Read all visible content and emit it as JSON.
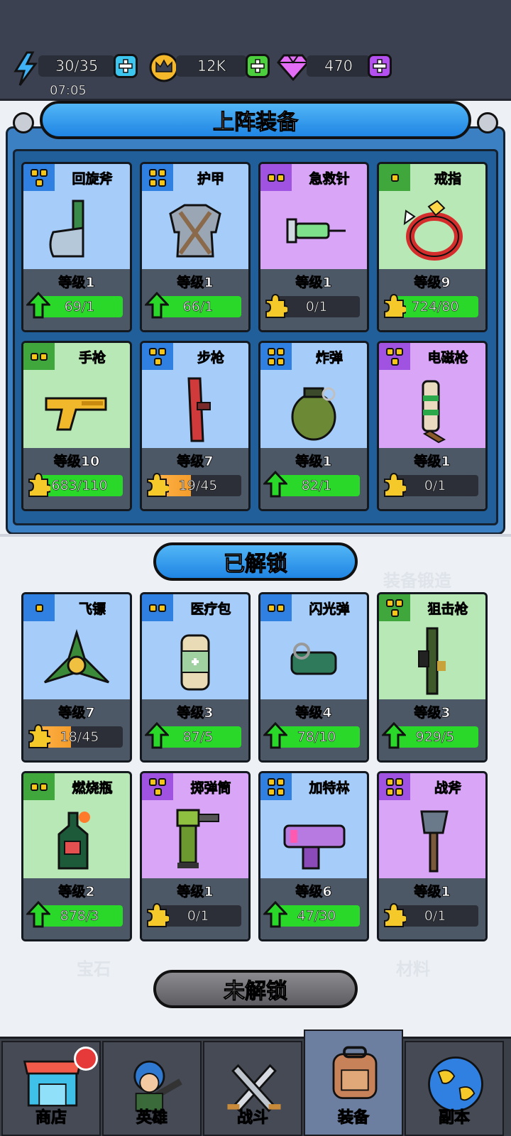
{
  "header": {
    "energy": "30/35",
    "timer": "07:05",
    "crowns": "12K",
    "gems": "470"
  },
  "equipped": {
    "title": "上阵装备",
    "cards": [
      {
        "name": "回旋斧",
        "color": "blue",
        "tag": 3,
        "level": "等级1",
        "progress": "69/1",
        "fill": 1.0,
        "upgrade": true,
        "icon": "axe-icon"
      },
      {
        "name": "护甲",
        "color": "blue",
        "tag": 4,
        "level": "等级1",
        "progress": "66/1",
        "fill": 1.0,
        "upgrade": true,
        "icon": "armor-icon"
      },
      {
        "name": "急救针",
        "color": "purple",
        "tag": 2,
        "level": "等级1",
        "progress": "0/1",
        "fill": 0.0,
        "upgrade": false,
        "icon": "syringe-icon"
      },
      {
        "name": "戒指",
        "color": "green",
        "tag": 1,
        "level": "等级9",
        "progress": "724/80",
        "fill": 1.0,
        "upgrade": false,
        "icon": "ring-icon"
      },
      {
        "name": "手枪",
        "color": "green",
        "tag": 2,
        "level": "等级10",
        "progress": "683/110",
        "fill": 1.0,
        "upgrade": false,
        "icon": "pistol-icon"
      },
      {
        "name": "步枪",
        "color": "blue",
        "tag": 3,
        "level": "等级7",
        "progress": "19/45",
        "fill": 0.42,
        "upgrade": false,
        "icon": "rifle-icon"
      },
      {
        "name": "炸弹",
        "color": "blue",
        "tag": 4,
        "level": "等级1",
        "progress": "82/1",
        "fill": 1.0,
        "upgrade": true,
        "icon": "grenade-icon"
      },
      {
        "name": "电磁枪",
        "color": "purple",
        "tag": 3,
        "level": "等级1",
        "progress": "0/1",
        "fill": 0.0,
        "upgrade": false,
        "icon": "railgun-icon"
      }
    ]
  },
  "unlocked": {
    "title": "已解锁",
    "cards": [
      {
        "name": "飞镖",
        "color": "blue",
        "tag": 1,
        "level": "等级7",
        "progress": "18/45",
        "fill": 0.4,
        "upgrade": false,
        "icon": "shuriken-icon"
      },
      {
        "name": "医疗包",
        "color": "blue",
        "tag": 2,
        "level": "等级3",
        "progress": "87/5",
        "fill": 1.0,
        "upgrade": true,
        "icon": "medkit-icon"
      },
      {
        "name": "闪光弹",
        "color": "blue",
        "tag": 2,
        "level": "等级4",
        "progress": "78/10",
        "fill": 1.0,
        "upgrade": true,
        "icon": "flashbang-icon"
      },
      {
        "name": "狙击枪",
        "color": "green",
        "tag": 3,
        "level": "等级3",
        "progress": "929/5",
        "fill": 1.0,
        "upgrade": true,
        "icon": "sniper-icon"
      },
      {
        "name": "燃烧瓶",
        "color": "green",
        "tag": 2,
        "level": "等级2",
        "progress": "878/3",
        "fill": 1.0,
        "upgrade": true,
        "icon": "molotov-icon"
      },
      {
        "name": "掷弹筒",
        "color": "purple",
        "tag": 3,
        "level": "等级1",
        "progress": "0/1",
        "fill": 0.0,
        "upgrade": false,
        "icon": "launcher-icon"
      },
      {
        "name": "加特林",
        "color": "blue",
        "tag": 4,
        "level": "等级6",
        "progress": "47/30",
        "fill": 1.0,
        "upgrade": true,
        "icon": "gatling-icon"
      },
      {
        "name": "战斧",
        "color": "purple",
        "tag": 4,
        "level": "等级1",
        "progress": "0/1",
        "fill": 0.0,
        "upgrade": false,
        "icon": "battleaxe-icon"
      }
    ]
  },
  "locked": {
    "title": "未解锁"
  },
  "background_text": {
    "forge": "装备锻造",
    "gems": "宝石",
    "materials": "材料"
  },
  "nav": [
    {
      "label": "商店",
      "icon": "shop-icon",
      "badge": true
    },
    {
      "label": "英雄",
      "icon": "hero-icon",
      "badge": false
    },
    {
      "label": "战斗",
      "icon": "swords-icon",
      "badge": false
    },
    {
      "label": "装备",
      "icon": "backpack-icon",
      "badge": false,
      "active": true
    },
    {
      "label": "副本",
      "icon": "globe-icon",
      "badge": false
    }
  ],
  "colors": {
    "blue_card": "#a6cdfa",
    "purple_card": "#d9a5f7",
    "green_card": "#b8e8b5",
    "progress_full": "#2ad82a",
    "progress_partial": "#f39c2b"
  }
}
